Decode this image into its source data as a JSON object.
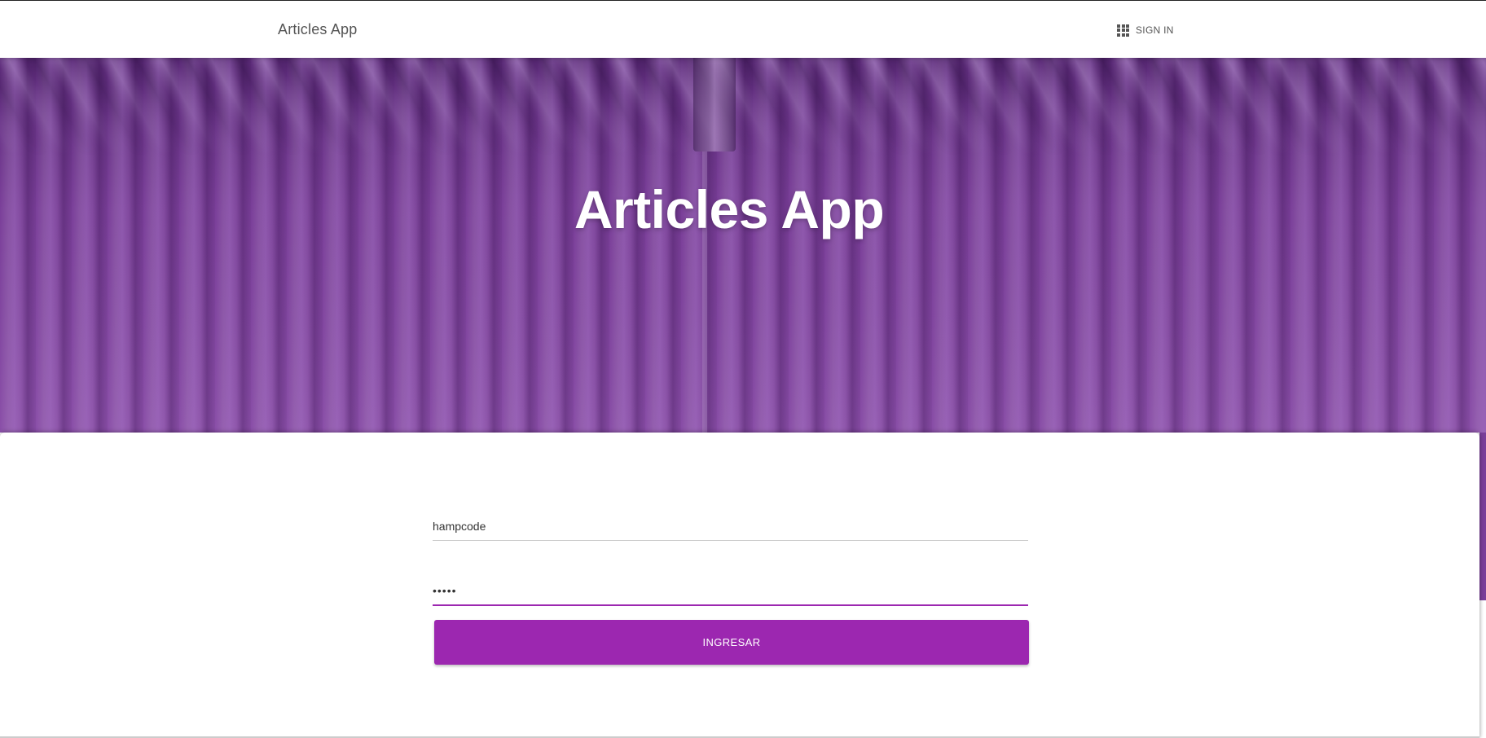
{
  "navbar": {
    "brand": "Articles App",
    "signin_label": "SIGN IN",
    "signin_icon": "apps-grid-icon"
  },
  "hero": {
    "title": "Articles App"
  },
  "login_form": {
    "username_value": "hampcode",
    "password_value": "hampc",
    "submit_label": "INGRESAR"
  },
  "colors": {
    "accent": "#9c27b0",
    "hero_tint": "#7a3f99"
  }
}
